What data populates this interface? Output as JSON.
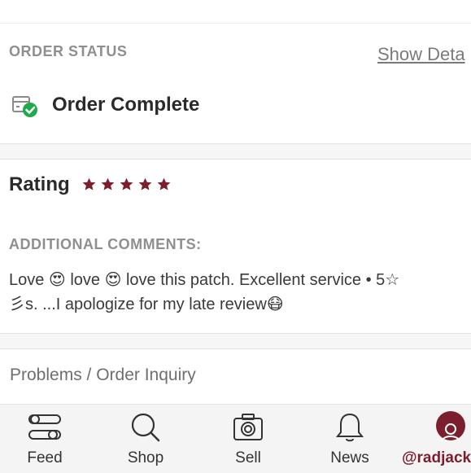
{
  "order": {
    "status_label": "ORDER STATUS",
    "show_details_label": "Show Deta",
    "status_text": "Order Complete"
  },
  "rating": {
    "label": "Rating",
    "stars": 5,
    "accent_color": "#7b1f2e"
  },
  "comments": {
    "label": "ADDITIONAL COMMENTS:",
    "text": "Love 😍 love 😍 love this patch. Excellent service • 5☆\n彡s. ...I apologize for my late review😷"
  },
  "problems": {
    "label": "Problems / Order Inquiry"
  },
  "tabbar": {
    "tabs": [
      {
        "label": "Feed",
        "icon": "feed-icon"
      },
      {
        "label": "Shop",
        "icon": "search-icon"
      },
      {
        "label": "Sell",
        "icon": "camera-icon"
      },
      {
        "label": "News",
        "icon": "bell-icon"
      },
      {
        "label": "@radjack",
        "icon": "avatar"
      }
    ]
  }
}
